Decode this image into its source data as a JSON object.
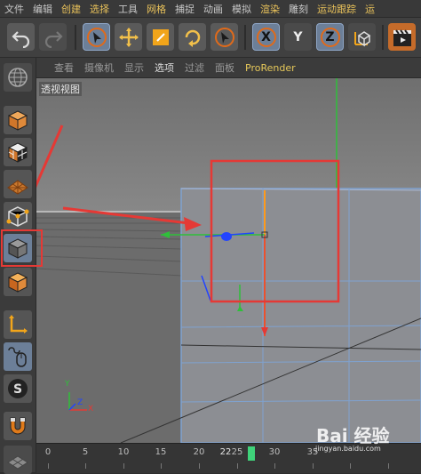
{
  "menubar": {
    "items": [
      {
        "label": "文件",
        "highlight": false
      },
      {
        "label": "编辑",
        "highlight": false
      },
      {
        "label": "创建",
        "highlight": true
      },
      {
        "label": "选择",
        "highlight": true
      },
      {
        "label": "工具",
        "highlight": false
      },
      {
        "label": "网格",
        "highlight": true
      },
      {
        "label": "捕捉",
        "highlight": false
      },
      {
        "label": "动画",
        "highlight": false
      },
      {
        "label": "模拟",
        "highlight": false
      },
      {
        "label": "渲染",
        "highlight": true
      },
      {
        "label": "雕刻",
        "highlight": false
      },
      {
        "label": "运动跟踪",
        "highlight": true
      },
      {
        "label": "运",
        "highlight": true
      }
    ]
  },
  "toolbar": {
    "axis_x": "X",
    "axis_y": "Y",
    "axis_z": "Z"
  },
  "viewport_menu": {
    "items": [
      "查看",
      "摄像机",
      "显示",
      "选项",
      "过滤",
      "面板",
      "ProRender"
    ],
    "selected": "选项"
  },
  "viewport": {
    "label": "透视视图",
    "axis_y_label": "Y",
    "axis_x_label": "X",
    "axis_z_label": "Z"
  },
  "timeline": {
    "ticks": [
      "0",
      "5",
      "10",
      "15",
      "20",
      "22",
      "25",
      "30",
      "35"
    ],
    "current": "22"
  },
  "watermark": {
    "main": "Bai  经验",
    "sub": "jingyan.baidu.com"
  },
  "colors": {
    "annotation_red": "#e53935",
    "axis_green": "#2fbf3a",
    "axis_blue": "#2244ff",
    "axis_orange": "#ff9a1a",
    "active_blue": "#6c7f98"
  }
}
